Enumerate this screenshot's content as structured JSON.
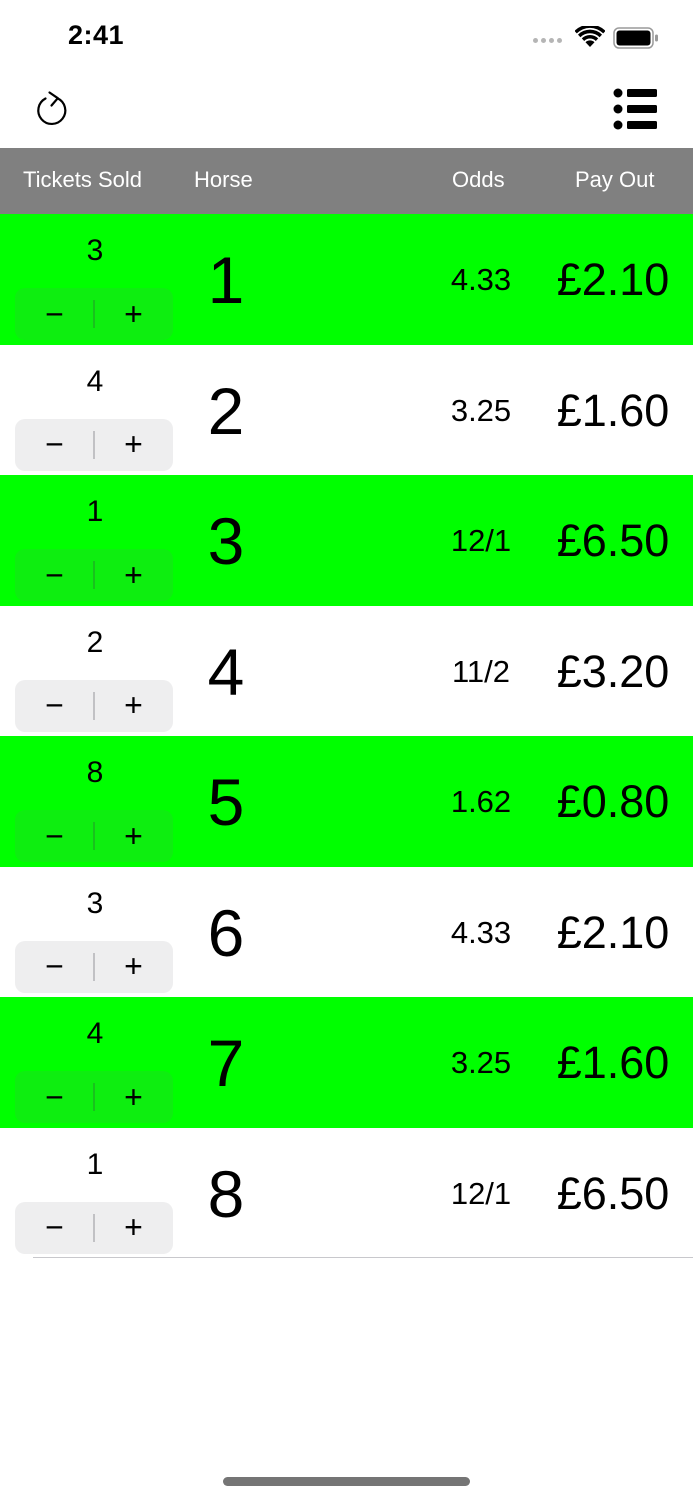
{
  "status_bar": {
    "time": "2:41"
  },
  "nav": {
    "refresh_icon": "refresh-icon",
    "list_icon": "list-icon"
  },
  "header": {
    "tickets_sold": "Tickets Sold",
    "horse": "Horse",
    "odds": "Odds",
    "pay_out": "Pay Out"
  },
  "colors": {
    "highlight": "#00ff00",
    "header_bg": "#808080"
  },
  "stepper": {
    "minus": "−",
    "plus": "+"
  },
  "rows": [
    {
      "tickets": "3",
      "horse": "1",
      "odds": "4.33",
      "payout": "£2.10",
      "highlight": true
    },
    {
      "tickets": "4",
      "horse": "2",
      "odds": "3.25",
      "payout": "£1.60",
      "highlight": false
    },
    {
      "tickets": "1",
      "horse": "3",
      "odds": "12/1",
      "payout": "£6.50",
      "highlight": true
    },
    {
      "tickets": "2",
      "horse": "4",
      "odds": "11/2",
      "payout": "£3.20",
      "highlight": false
    },
    {
      "tickets": "8",
      "horse": "5",
      "odds": "1.62",
      "payout": "£0.80",
      "highlight": true
    },
    {
      "tickets": "3",
      "horse": "6",
      "odds": "4.33",
      "payout": "£2.10",
      "highlight": false
    },
    {
      "tickets": "4",
      "horse": "7",
      "odds": "3.25",
      "payout": "£1.60",
      "highlight": true
    },
    {
      "tickets": "1",
      "horse": "8",
      "odds": "12/1",
      "payout": "£6.50",
      "highlight": false
    }
  ]
}
